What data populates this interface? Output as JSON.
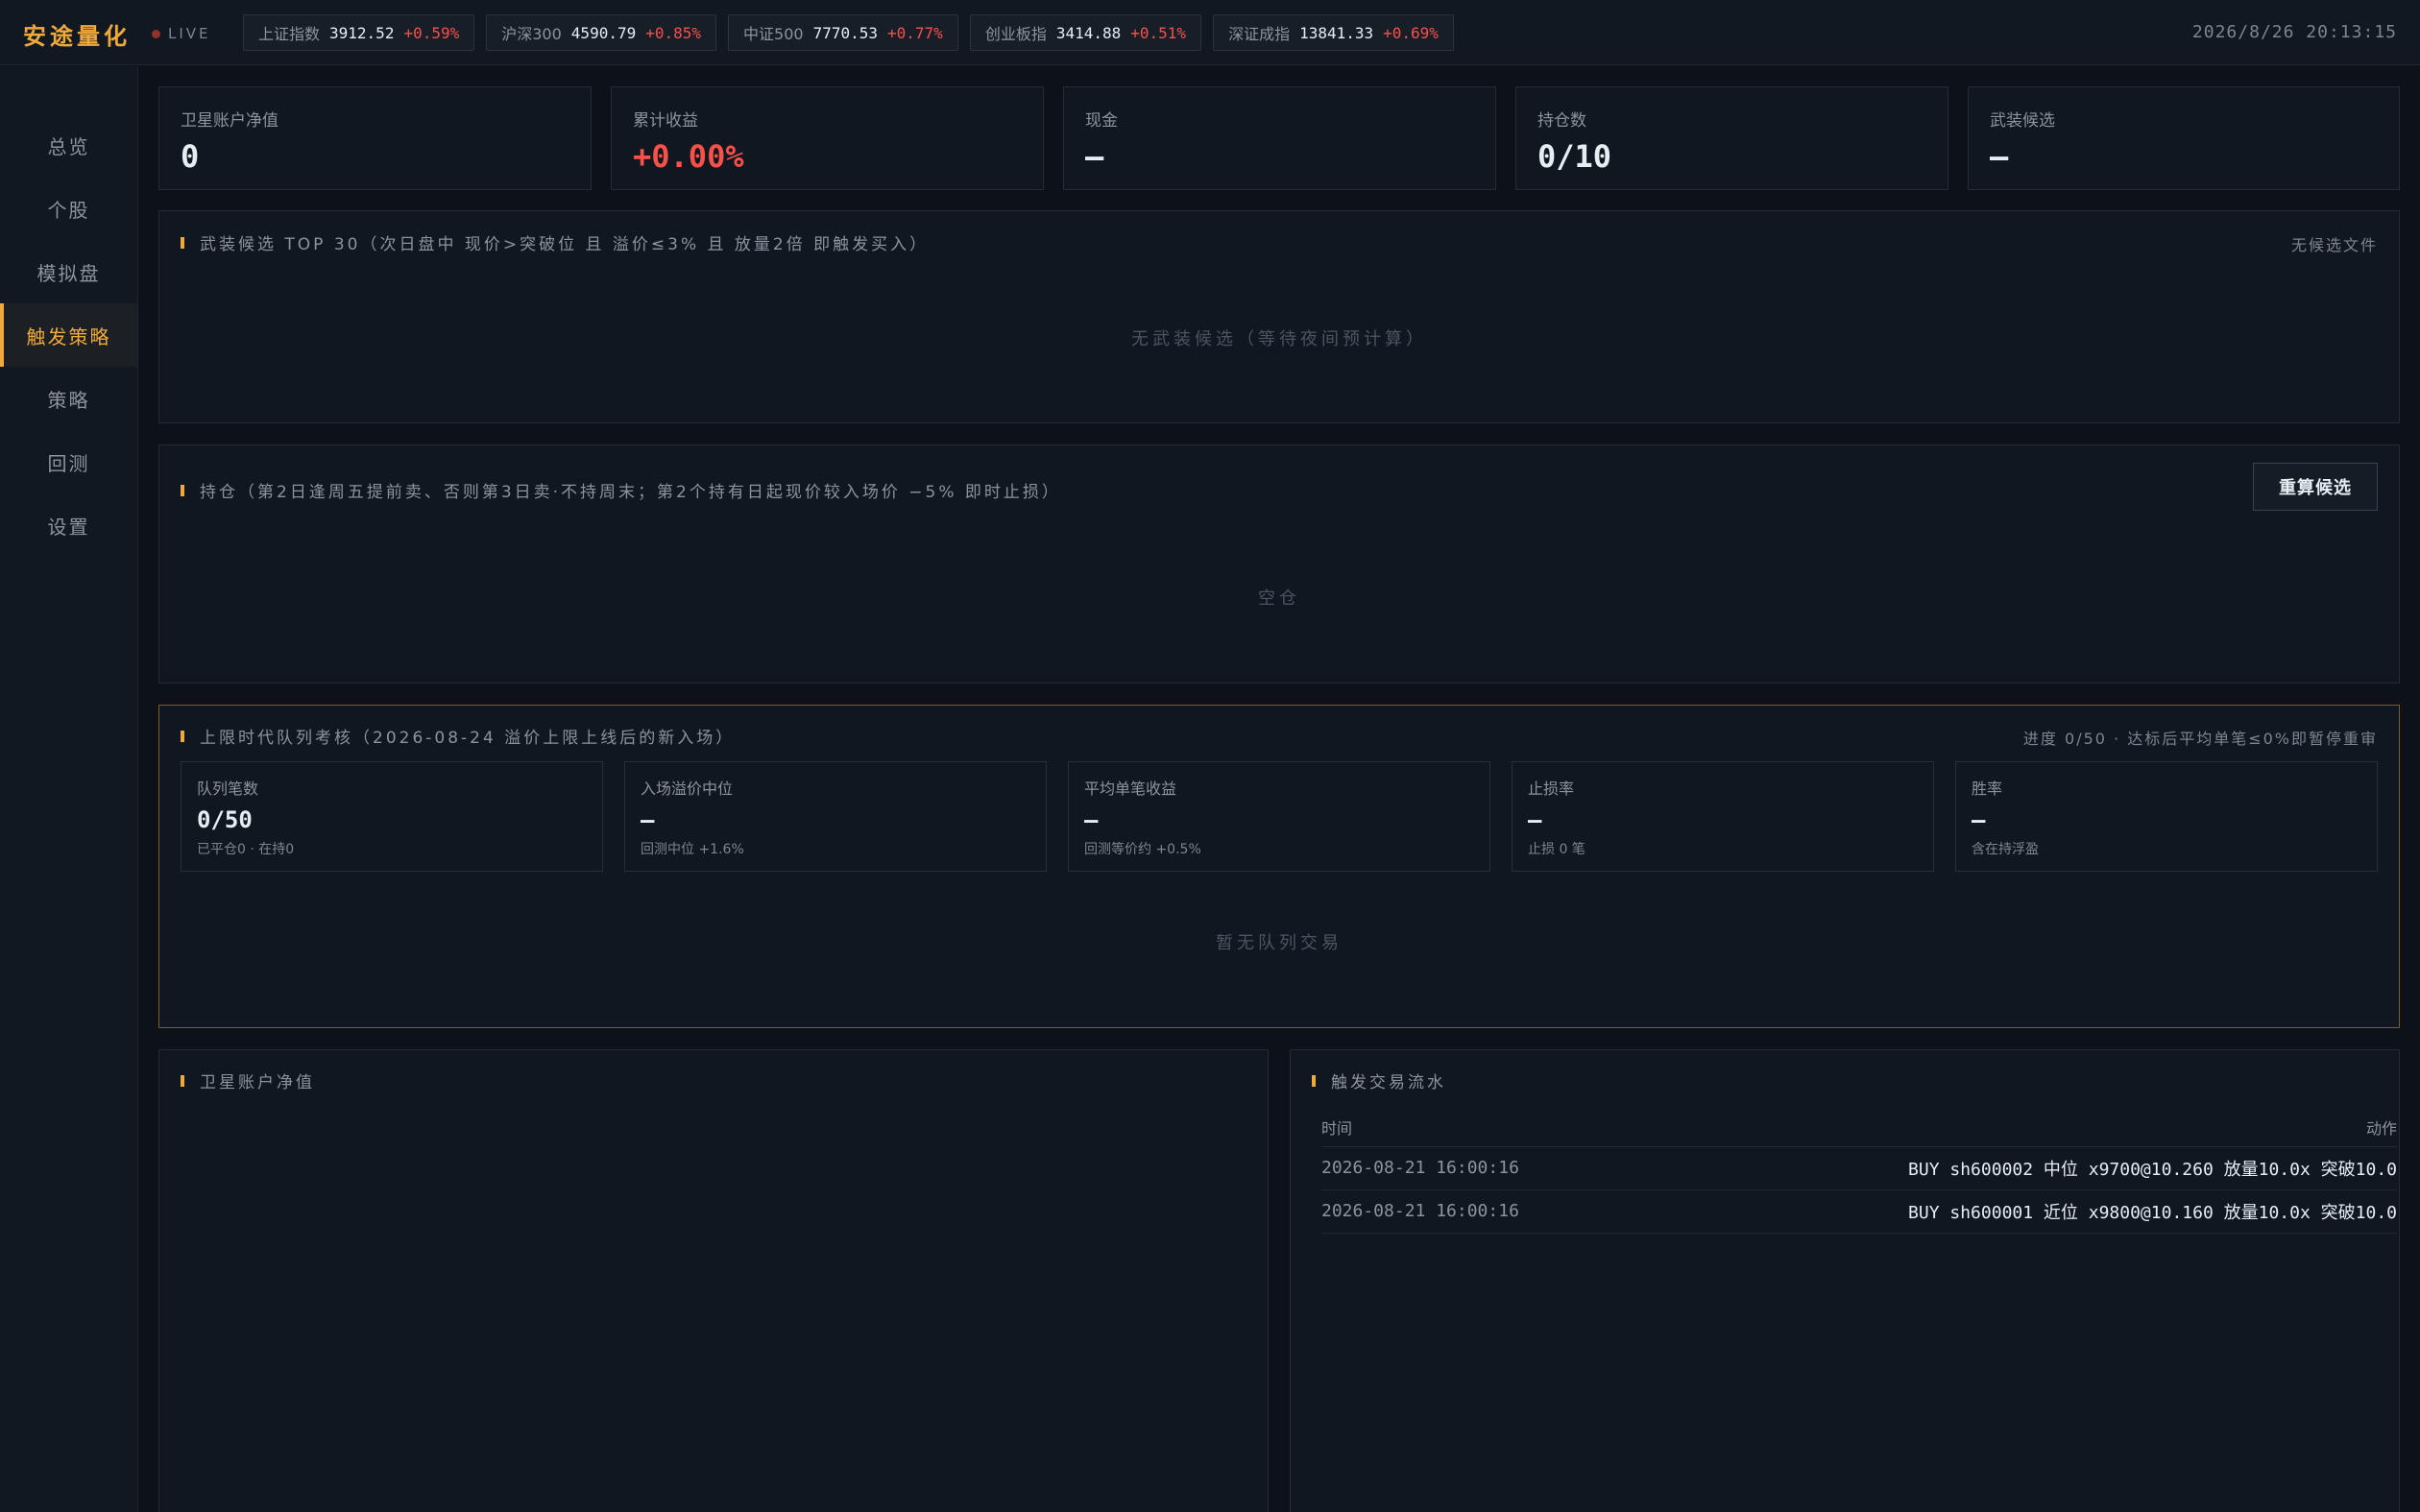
{
  "brand": "安途量化",
  "live_label": "LIVE",
  "datetime": "2026/8/26 20:13:15",
  "tickers": [
    {
      "name": "上证指数",
      "value": "3912.52",
      "change": "+0.59%"
    },
    {
      "name": "沪深300",
      "value": "4590.79",
      "change": "+0.85%"
    },
    {
      "name": "中证500",
      "value": "7770.53",
      "change": "+0.77%"
    },
    {
      "name": "创业板指",
      "value": "3414.88",
      "change": "+0.51%"
    },
    {
      "name": "深证成指",
      "value": "13841.33",
      "change": "+0.69%"
    }
  ],
  "nav": [
    {
      "label": "总览"
    },
    {
      "label": "个股"
    },
    {
      "label": "模拟盘"
    },
    {
      "label": "触发策略"
    },
    {
      "label": "策略"
    },
    {
      "label": "回测"
    },
    {
      "label": "设置"
    }
  ],
  "nav_active": 3,
  "stats": [
    {
      "label": "卫星账户净值",
      "value": "0"
    },
    {
      "label": "累计收益",
      "value": "+0.00%"
    },
    {
      "label": "现金",
      "value": "—"
    },
    {
      "label": "持仓数",
      "value": "0/10"
    },
    {
      "label": "武装候选",
      "value": "—"
    }
  ],
  "candidates": {
    "title": "武装候选 TOP 30（次日盘中 现价>突破位 且 溢价≤3% 且 放量2倍 即触发买入）",
    "right": "无候选文件",
    "empty": "无武装候选（等待夜间预计算）"
  },
  "positions": {
    "title": "持仓（第2日逢周五提前卖、否则第3日卖·不持周末；第2个持有日起现价较入场价 −5% 即时止损）",
    "button": "重算候选",
    "empty": "空仓"
  },
  "queue": {
    "title": "上限时代队列考核（2026-08-24 溢价上限上线后的新入场）",
    "right": "进度 0/50 · 达标后平均单笔≤0%即暂停重审",
    "cards": [
      {
        "label": "队列笔数",
        "value": "0/50",
        "sub": "已平仓0 · 在持0"
      },
      {
        "label": "入场溢价中位",
        "value": "—",
        "sub": "回测中位 +1.6%"
      },
      {
        "label": "平均单笔收益",
        "value": "—",
        "sub": "回测等价约 +0.5%"
      },
      {
        "label": "止损率",
        "value": "—",
        "sub": "止损 0 笔"
      },
      {
        "label": "胜率",
        "value": "—",
        "sub": "含在持浮盈"
      }
    ],
    "empty": "暂无队列交易"
  },
  "nav_chart": {
    "title": "卫星账户净值"
  },
  "trade_flow": {
    "title": "触发交易流水",
    "col_time": "时间",
    "col_action": "动作",
    "rows": [
      {
        "time": "2026-08-21 16:00:16",
        "action": "BUY sh600002 中位 x9700@10.260 放量10.0x 突破10.0"
      },
      {
        "time": "2026-08-21 16:00:16",
        "action": "BUY sh600001 近位 x9800@10.160 放量10.0x 突破10.0"
      }
    ]
  },
  "colors": {
    "accent": "#f0a93b",
    "up": "#f85149",
    "background": "#0d121a",
    "panel": "#111720"
  }
}
